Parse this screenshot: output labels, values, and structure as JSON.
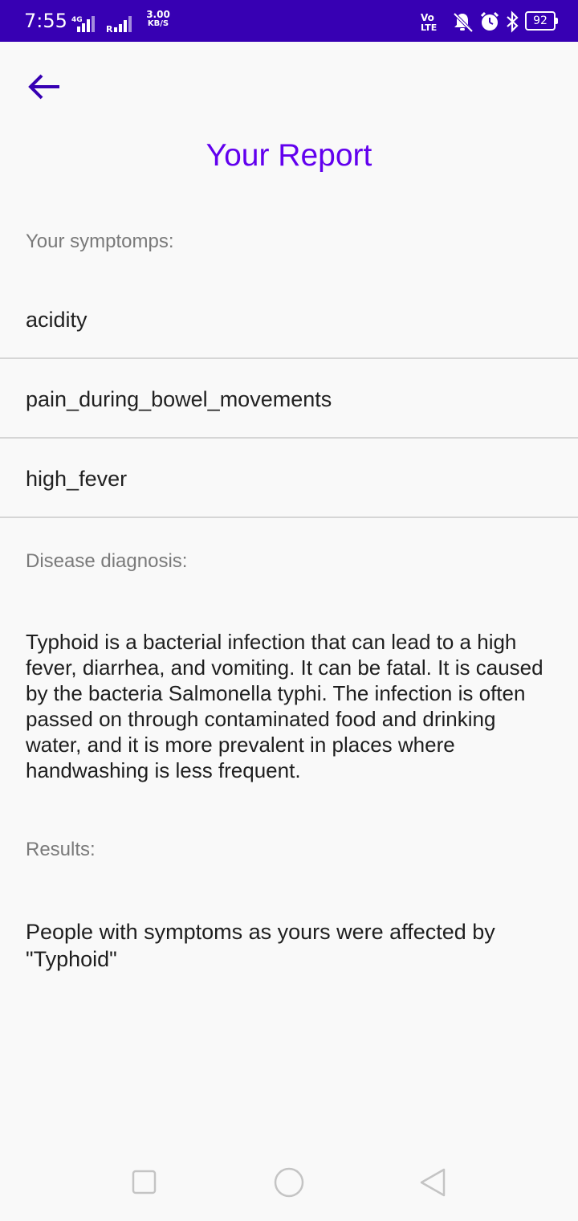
{
  "status_bar": {
    "time": "7:55",
    "network_type": "4G",
    "roaming": "R",
    "net_speed_value": "3.00",
    "net_speed_unit": "KB/S",
    "volte": "VoLTE",
    "battery_level": "92",
    "background_color": "#3700b3"
  },
  "header": {
    "back_icon": "arrow-left-icon",
    "title": "Your Report",
    "accent_color": "#6200ee"
  },
  "symptoms": {
    "label": "Your symptomps:",
    "items": [
      "acidity",
      "pain_during_bowel_movements",
      "high_fever"
    ]
  },
  "diagnosis": {
    "label": "Disease diagnosis:",
    "text": "Typhoid is a bacterial infection that can lead to a high fever, diarrhea, and vomiting. It can be fatal. It is caused by the bacteria Salmonella typhi. The infection is often passed on through contaminated food and drinking water, and it is more prevalent in places where handwashing is less frequent."
  },
  "results": {
    "label": "Results:",
    "text": "People with symptoms as yours were affected by \"Typhoid\""
  },
  "nav_bar": {
    "icons": [
      "recents-square-icon",
      "home-circle-icon",
      "back-triangle-icon"
    ]
  }
}
